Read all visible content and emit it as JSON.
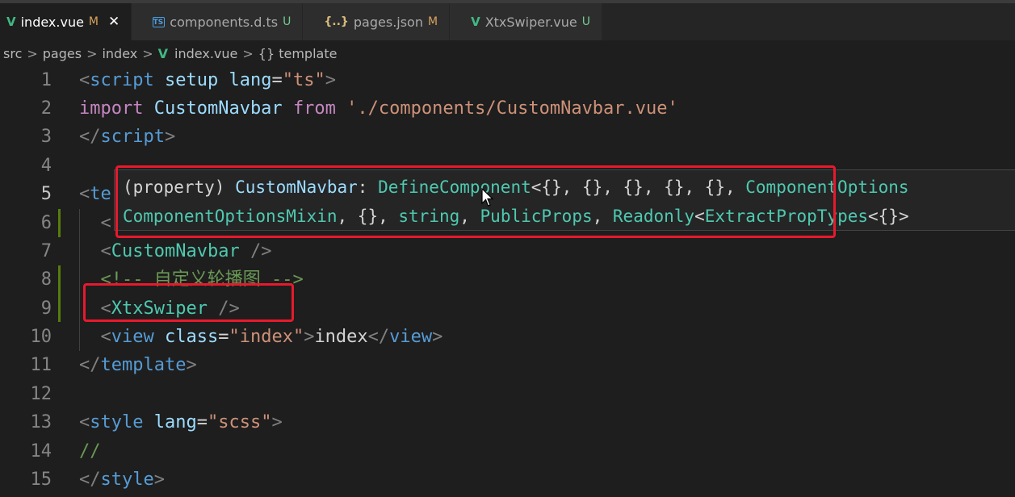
{
  "tabs": [
    {
      "icon": "vue-icon",
      "glyph": "V",
      "name": "index.vue",
      "status": "M",
      "active": true,
      "close": "✕"
    },
    {
      "icon": "typescript-icon",
      "glyph": "TS",
      "name": "components.d.ts",
      "status": "U",
      "active": false
    },
    {
      "icon": "json-icon",
      "glyph": "{..}",
      "name": "pages.json",
      "status": "M",
      "active": false
    },
    {
      "icon": "vue-icon",
      "glyph": "V",
      "name": "XtxSwiper.vue",
      "status": "U",
      "active": false
    }
  ],
  "breadcrumb": {
    "items": [
      "src",
      "pages",
      "index",
      "index.vue",
      "{} template"
    ],
    "vue_glyph": "V",
    "separator": ">"
  },
  "line_numbers": [
    "1",
    "2",
    "3",
    "4",
    "5",
    "6",
    "7",
    "8",
    "9",
    "10",
    "11",
    "12",
    "13",
    "14",
    "15"
  ],
  "code": {
    "l1_open": "<",
    "l1_tag": "script",
    "l1_attr1": "setup",
    "l1_attr2": "lang",
    "l1_eq": "=",
    "l1_val": "\"ts\"",
    "l1_close": ">",
    "l2_kw1": "import",
    "l2_ident": "CustomNavbar",
    "l2_kw2": "from",
    "l2_str": "'./components/CustomNavbar.vue'",
    "l3_open": "</",
    "l3_tag": "script",
    "l3_close": ">",
    "l5_open": "<",
    "l5_tag": "te",
    "l6_open": "<",
    "l7_open": "<",
    "l7_comp": "CustomNavbar",
    "l7_close": " />",
    "l8_comment": "<!-- 自定义轮播图 -->",
    "l9_open": "<",
    "l9_comp": "XtxSwiper",
    "l9_close": " />",
    "l10_open": "<",
    "l10_tag": "view",
    "l10_attr": "class",
    "l10_eq": "=",
    "l10_val": "\"index\"",
    "l10_gt": ">",
    "l10_text": "index",
    "l10_endopen": "</",
    "l10_endtag": "view",
    "l10_endclose": ">",
    "l11_open": "</",
    "l11_tag": "template",
    "l11_close": ">",
    "l13_open": "<",
    "l13_tag": "style",
    "l13_attr": "lang",
    "l13_eq": "=",
    "l13_val": "\"scss\"",
    "l13_close": ">",
    "l14_comment": "//",
    "l15_open": "</",
    "l15_tag": "style",
    "l15_close": ">"
  },
  "hover": {
    "l1_p1": "(property) ",
    "l1_name": "CustomNavbar",
    "l1_colon": ": ",
    "l1_fn": "DefineComponent",
    "l1_args": "<{}, {}, {}, {}, {}, ",
    "l1_type": "ComponentOptions",
    "l2_type1": "ComponentOptionsMixin",
    "l2_p1": ", {}, ",
    "l2_kw": "string",
    "l2_p2": ", ",
    "l2_type2": "PublicProps",
    "l2_p3": ", ",
    "l2_type3": "Readonly",
    "l2_p4": "<",
    "l2_type4": "ExtractPropTypes",
    "l2_p5": "<{}>"
  },
  "colors": {
    "annotation": "#e8192c",
    "editor_bg": "#1e1e1e",
    "vue_green": "#41b883"
  }
}
